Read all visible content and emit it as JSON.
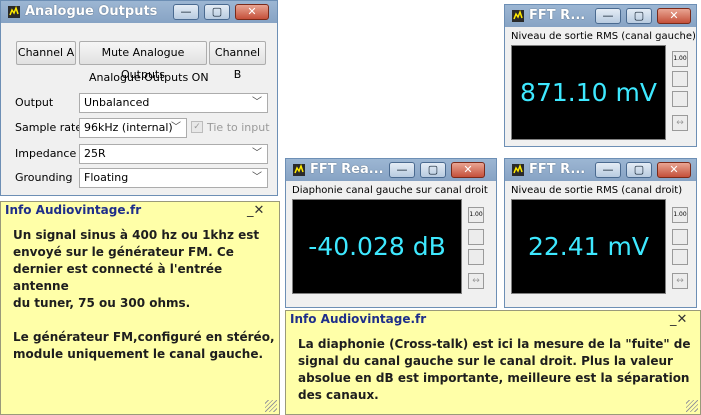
{
  "analogue": {
    "title": "Analogue Outputs",
    "btn_a": "Channel A",
    "btn_mute": "Mute Analogue Outputs",
    "btn_b": "Channel B",
    "status": "Analogue Outputs ON",
    "output_label": "Output",
    "output_value": "Unbalanced",
    "rate_label": "Sample rate",
    "rate_value": "96kHz (internal)",
    "tie_label": "Tie to input",
    "imp_label": "Impedance",
    "imp_value": "25R",
    "ground_label": "Grounding",
    "ground_value": "Floating"
  },
  "fft_top": {
    "title": "FFT R...",
    "caption": "Niveau de sortie RMS (canal gauche)",
    "value": "871.10 mV"
  },
  "fft_mid": {
    "title": "FFT Rea...",
    "caption": "Diaphonie canal gauche sur canal droit",
    "value": "-40.028 dB"
  },
  "fft_right": {
    "title": "FFT R...",
    "caption": "Niveau de sortie RMS (canal droit)",
    "value": "22.41 mV"
  },
  "side_buttons": {
    "a": "1.00",
    "b": "",
    "c": "",
    "d": "↔"
  },
  "note1": {
    "title": "Info Audiovintage.fr",
    "body": "Un signal sinus à 400 hz ou 1khz est\nenvoyé sur le générateur FM. Ce\ndernier est connecté à l'entrée antenne\ndu tuner, 75 ou 300 ohms.\n\nLe générateur FM,configuré en stéréo,\nmodule uniquement le canal gauche."
  },
  "note2": {
    "title": "Info Audiovintage.fr",
    "body": "La diaphonie (Cross-talk) est ici la mesure de la \"fuite\" de\nsignal du canal gauche sur le canal droit. Plus la valeur\nabsolue en dB est importante, meilleure est la séparation\ndes canaux."
  },
  "glyphs": {
    "min": "—",
    "max": "▢",
    "close": "✕",
    "note_close": "_✕",
    "arrow": "﹀",
    "check": "✓"
  }
}
